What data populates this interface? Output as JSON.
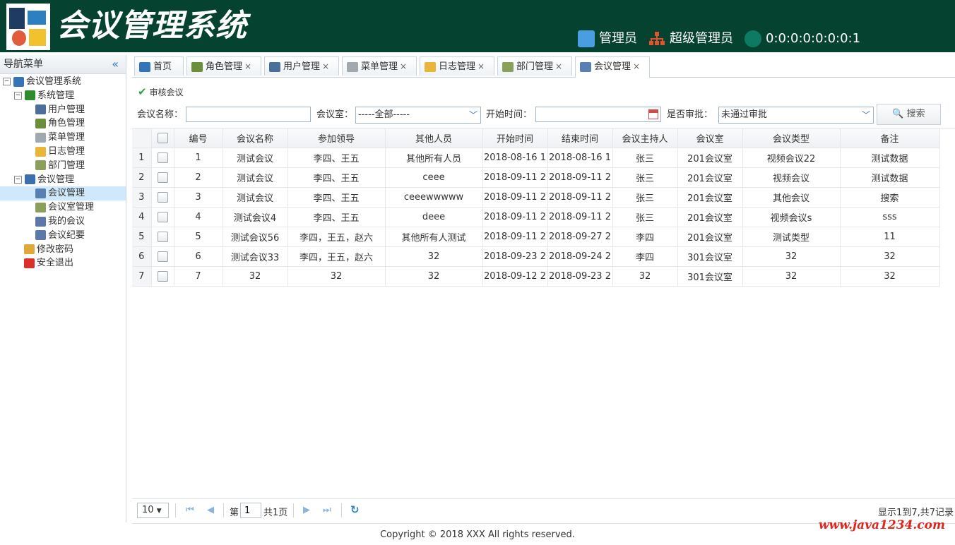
{
  "header": {
    "title": "会议管理系统",
    "user": "管理员",
    "role": "超级管理员",
    "ip": "0:0:0:0:0:0:0:1"
  },
  "sidebar": {
    "title": "导航菜单",
    "collapse_glyph": "«",
    "tree": [
      {
        "label": "会议管理系统",
        "level": 0,
        "toggle": "⊟",
        "icon": "home-icon",
        "color": "#3574b9"
      },
      {
        "label": "系统管理",
        "level": 1,
        "toggle": "⊟",
        "icon": "folder-green-icon",
        "color": "#2e8b2e"
      },
      {
        "label": "用户管理",
        "level": 2,
        "icon": "user-icon",
        "color": "#4a6f9b"
      },
      {
        "label": "角色管理",
        "level": 2,
        "icon": "role-icon",
        "color": "#6b8e3a"
      },
      {
        "label": "菜单管理",
        "level": 2,
        "icon": "menu-icon",
        "color": "#a0a8b0"
      },
      {
        "label": "日志管理",
        "level": 2,
        "icon": "log-folder-icon",
        "color": "#e8b73a"
      },
      {
        "label": "部门管理",
        "level": 2,
        "icon": "dept-table-icon",
        "color": "#8aa05a"
      },
      {
        "label": "会议管理",
        "level": 1,
        "toggle": "⊟",
        "icon": "monitor-icon",
        "color": "#3d6fb0"
      },
      {
        "label": "会议管理",
        "level": 2,
        "icon": "meeting-icon",
        "color": "#5a7fb5",
        "selected": true
      },
      {
        "label": "会议室管理",
        "level": 2,
        "icon": "room-table-icon",
        "color": "#8aa05a"
      },
      {
        "label": "我的会议",
        "level": 2,
        "icon": "my-meeting-icon",
        "color": "#5c78a8"
      },
      {
        "label": "会议纪要",
        "level": 2,
        "icon": "minutes-icon",
        "color": "#5c78a8"
      },
      {
        "label": "修改密码",
        "level": 1,
        "icon": "password-icon",
        "color": "#e0a83a"
      },
      {
        "label": "安全退出",
        "level": 1,
        "icon": "exit-icon",
        "color": "#d9302a"
      }
    ]
  },
  "tabs": [
    {
      "label": "首页",
      "icon": "home-icon",
      "color": "#3574b9",
      "closable": false
    },
    {
      "label": "角色管理",
      "icon": "role-icon",
      "color": "#6b8e3a",
      "closable": true
    },
    {
      "label": "用户管理",
      "icon": "user-icon",
      "color": "#4a6f9b",
      "closable": true
    },
    {
      "label": "菜单管理",
      "icon": "menu-icon",
      "color": "#a0a8b0",
      "closable": true
    },
    {
      "label": "日志管理",
      "icon": "log-folder-icon",
      "color": "#e8b73a",
      "closable": true
    },
    {
      "label": "部门管理",
      "icon": "dept-table-icon",
      "color": "#8aa05a",
      "closable": true
    },
    {
      "label": "会议管理",
      "icon": "meeting-icon",
      "color": "#5a7fb5",
      "closable": true,
      "active": true
    }
  ],
  "toolbar": {
    "audit_label": "审核会议"
  },
  "filters": {
    "name_label": "会议名称：",
    "name_value": "",
    "room_label": "会议室：",
    "room_value": "-----全部-----",
    "start_label": "开始时间：",
    "start_value": "",
    "approve_label": "是否审批：",
    "approve_value": "未通过审批",
    "search_label": "搜索"
  },
  "table": {
    "columns": [
      "编号",
      "会议名称",
      "参加领导",
      "其他人员",
      "开始时间",
      "结束时间",
      "会议主持人",
      "会议室",
      "会议类型",
      "备注"
    ],
    "rows": [
      [
        "1",
        "测试会议",
        "李四、王五",
        "其他所有人员",
        "2018-08-16 1",
        "2018-08-16 1",
        "张三",
        "201会议室",
        "视频会议22",
        "测试数据"
      ],
      [
        "2",
        "测试会议",
        "李四、王五",
        "ceee",
        "2018-09-11 2",
        "2018-09-11 2",
        "张三",
        "201会议室",
        "视频会议",
        "测试数据"
      ],
      [
        "3",
        "测试会议",
        "李四、王五",
        "ceeewwwww",
        "2018-09-11 2",
        "2018-09-11 2",
        "张三",
        "201会议室",
        "其他会议",
        "搜索"
      ],
      [
        "4",
        "测试会议4",
        "李四、王五",
        "deee",
        "2018-09-11 2",
        "2018-09-11 2",
        "张三",
        "201会议室",
        "视频会议s",
        "sss"
      ],
      [
        "5",
        "测试会议56",
        "李四，王五，赵六",
        "其他所有人测试",
        "2018-09-11 2",
        "2018-09-27 2",
        "李四",
        "201会议室",
        "测试类型",
        "11"
      ],
      [
        "6",
        "测试会议33",
        "李四，王五，赵六",
        "32",
        "2018-09-23 2",
        "2018-09-24 2",
        "李四",
        "301会议室",
        "32",
        "32"
      ],
      [
        "7",
        "32",
        "32",
        "32",
        "2018-09-12 2",
        "2018-09-23 2",
        "32",
        "301会议室",
        "32",
        "32"
      ]
    ]
  },
  "pager": {
    "page_size": "10",
    "page_prefix": "第",
    "page_value": "1",
    "page_suffix": "共1页",
    "info": "显示1到7,共7记录"
  },
  "footer": {
    "copyright": "Copyright © 2018 XXX All rights reserved.",
    "watermark": "www.java1234.com"
  }
}
